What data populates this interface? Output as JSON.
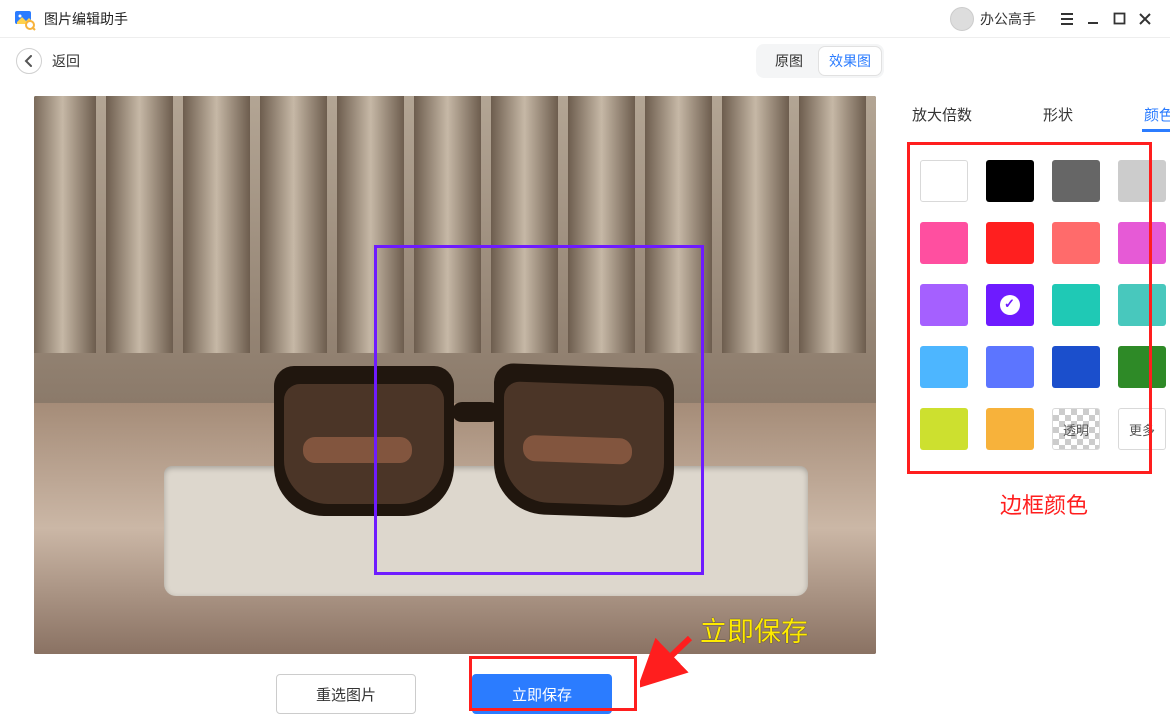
{
  "titlebar": {
    "app_title": "图片编辑助手",
    "user_label": "办公高手"
  },
  "toolbar": {
    "back_label": "返回",
    "view_original": "原图",
    "view_result": "效果图"
  },
  "buttons": {
    "reselect": "重选图片",
    "save": "立即保存"
  },
  "panel": {
    "tabs": {
      "zoom": "放大倍数",
      "shape": "形状",
      "color": "颜色"
    },
    "colors": [
      {
        "hex": "#ffffff",
        "name": "white"
      },
      {
        "hex": "#000000",
        "name": "black"
      },
      {
        "hex": "#666666",
        "name": "dark-gray"
      },
      {
        "hex": "#cccccc",
        "name": "light-gray"
      },
      {
        "hex": "#ff4fa0",
        "name": "pink"
      },
      {
        "hex": "#ff1f1f",
        "name": "red"
      },
      {
        "hex": "#ff6b6b",
        "name": "salmon"
      },
      {
        "hex": "#e65ad6",
        "name": "magenta"
      },
      {
        "hex": "#a560ff",
        "name": "violet"
      },
      {
        "hex": "#6e1bff",
        "name": "purple",
        "selected": true
      },
      {
        "hex": "#1fc9b5",
        "name": "teal"
      },
      {
        "hex": "#48c8bd",
        "name": "cyan"
      },
      {
        "hex": "#4db6ff",
        "name": "light-blue"
      },
      {
        "hex": "#5c75ff",
        "name": "indigo"
      },
      {
        "hex": "#1b4fcc",
        "name": "blue"
      },
      {
        "hex": "#2e8a27",
        "name": "green"
      },
      {
        "hex": "#cde02f",
        "name": "lime"
      },
      {
        "hex": "#f7b23b",
        "name": "amber"
      }
    ],
    "transparent_label": "透明",
    "more_label": "更多"
  },
  "annotations": {
    "border_color": "边框颜色",
    "save_now": "立即保存"
  }
}
